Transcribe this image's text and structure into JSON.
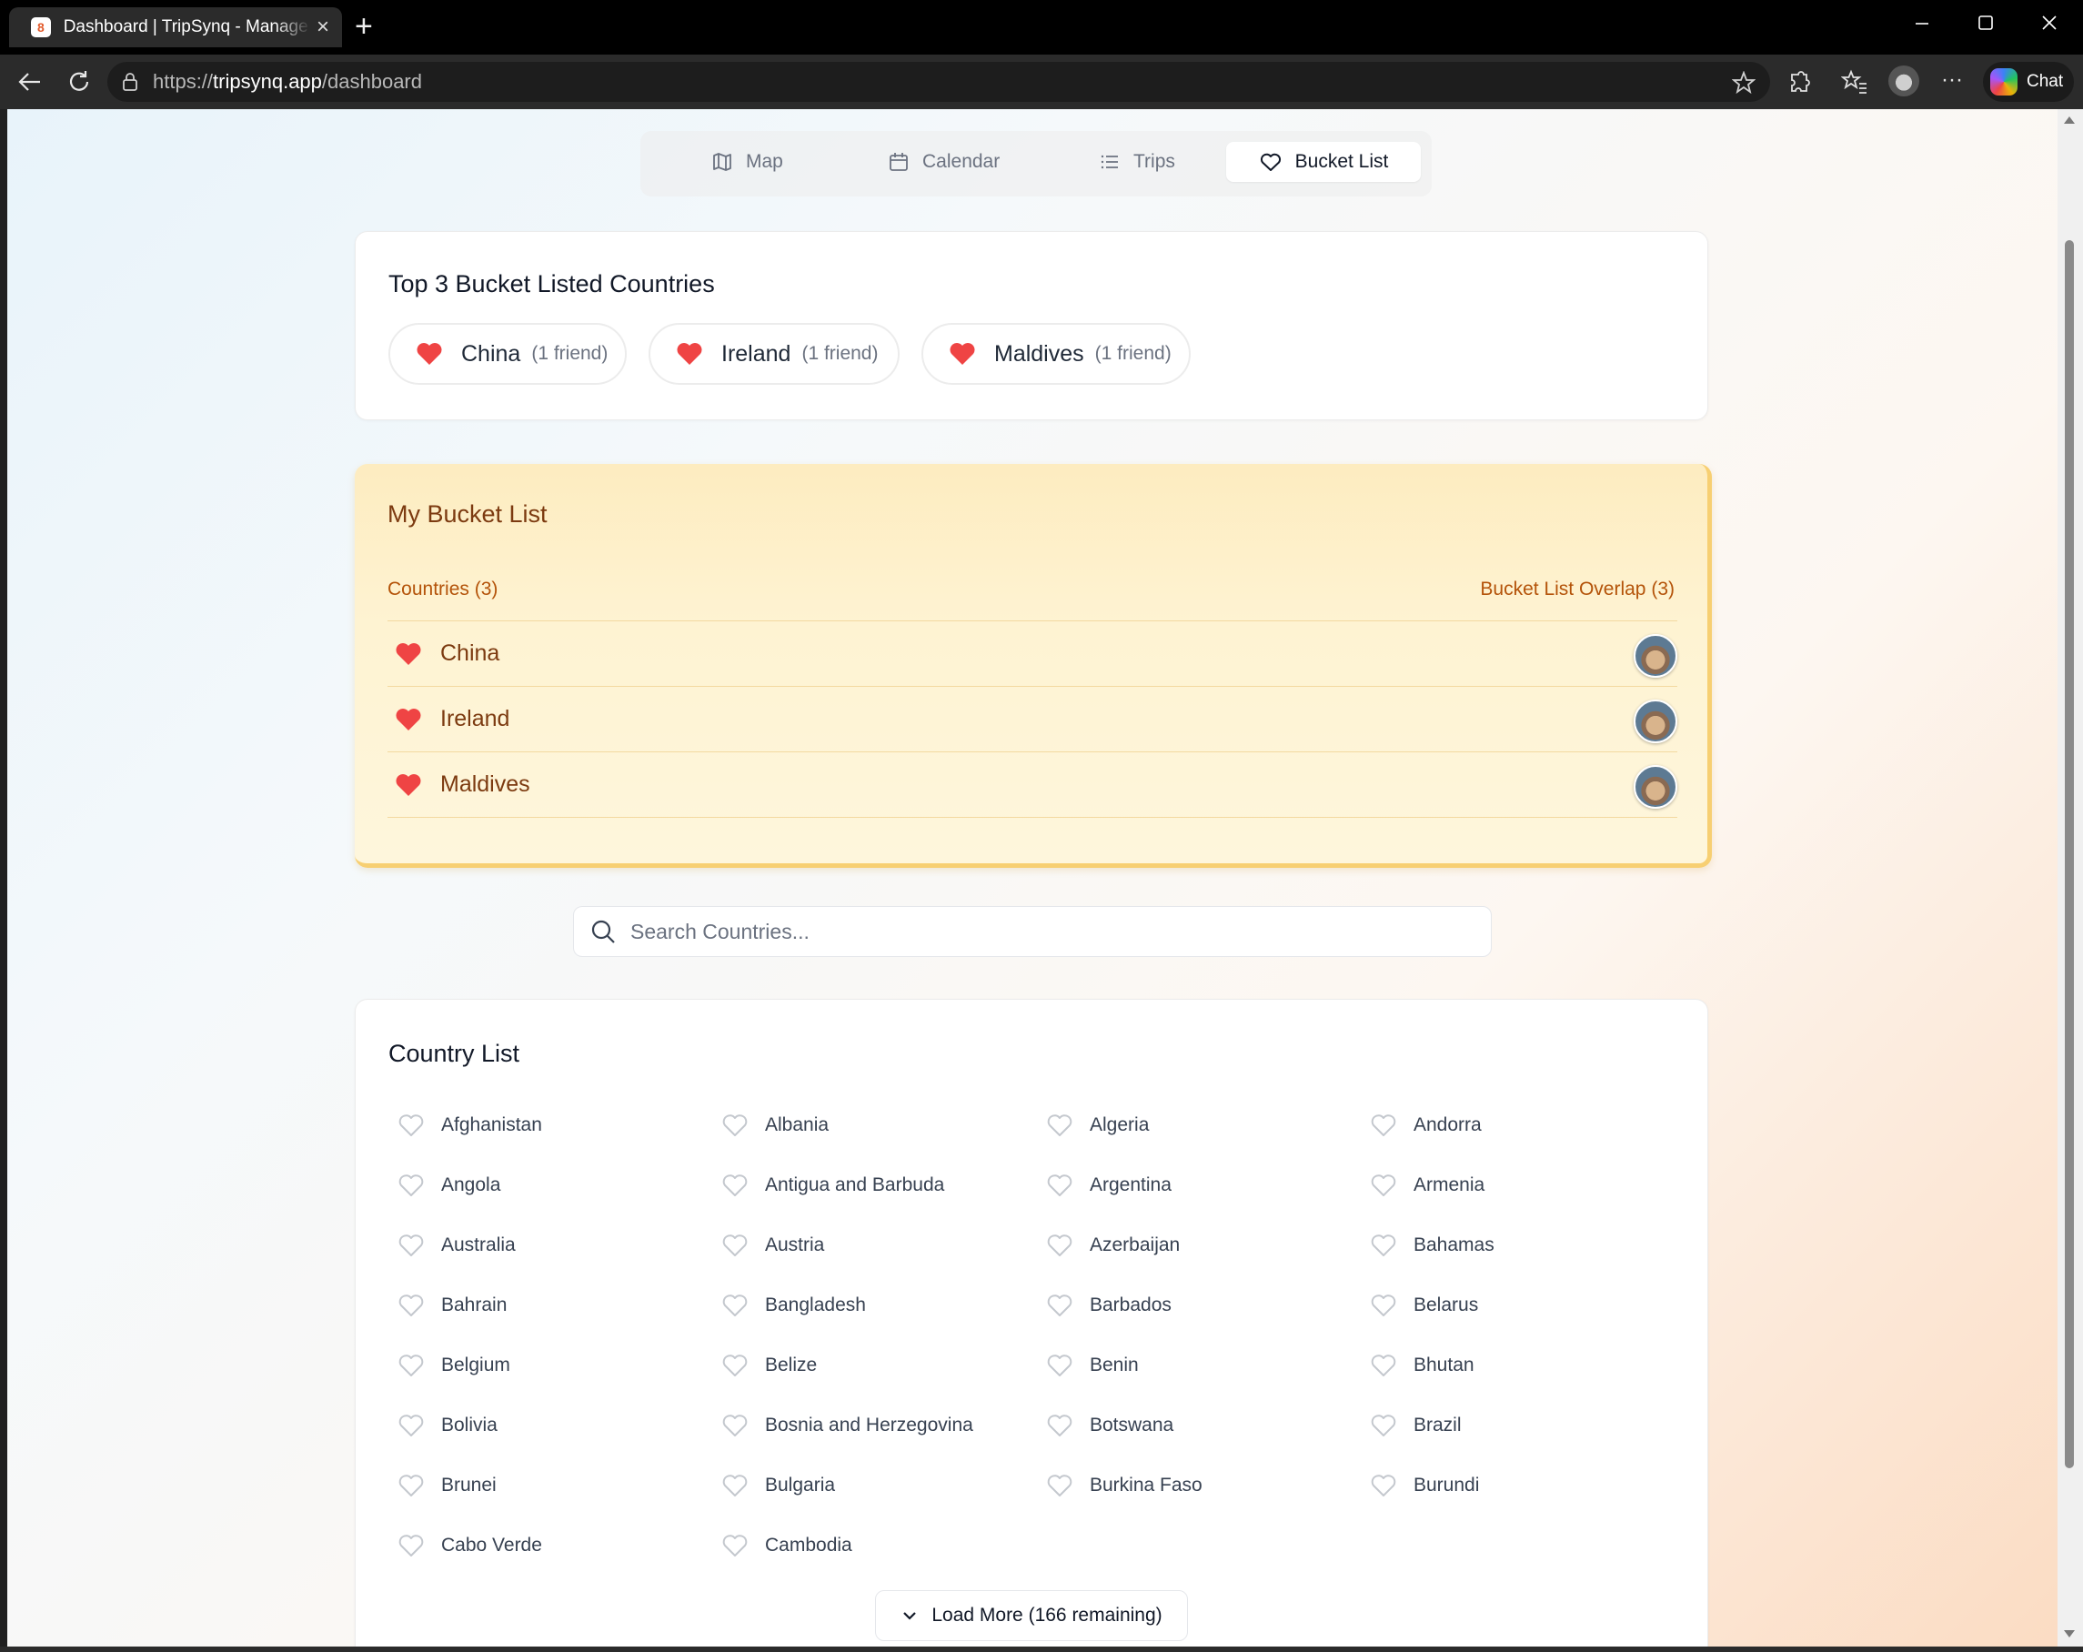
{
  "browser": {
    "tab_title": "Dashboard | TripSynq - Manage Your Trips",
    "url_prefix": "https://",
    "url_domain": "tripsynq.app",
    "url_path": "/dashboard",
    "chat_label": "Chat"
  },
  "nav": {
    "tabs": [
      {
        "label": "Map",
        "icon": "map-icon"
      },
      {
        "label": "Calendar",
        "icon": "calendar-icon"
      },
      {
        "label": "Trips",
        "icon": "list-icon"
      },
      {
        "label": "Bucket List",
        "icon": "heart-icon",
        "active": true
      }
    ]
  },
  "top3": {
    "title": "Top 3 Bucket Listed Countries",
    "items": [
      {
        "name": "China",
        "count": "(1 friend)"
      },
      {
        "name": "Ireland",
        "count": "(1 friend)"
      },
      {
        "name": "Maldives",
        "count": "(1 friend)"
      }
    ]
  },
  "my_bucket": {
    "title": "My Bucket List",
    "countries_label": "Countries (3)",
    "overlap_label": "Bucket List Overlap (3)",
    "items": [
      {
        "name": "China"
      },
      {
        "name": "Ireland"
      },
      {
        "name": "Maldives"
      }
    ]
  },
  "search": {
    "placeholder": "Search Countries..."
  },
  "country_list": {
    "title": "Country List",
    "items": [
      "Afghanistan",
      "Albania",
      "Algeria",
      "Andorra",
      "Angola",
      "Antigua and Barbuda",
      "Argentina",
      "Armenia",
      "Australia",
      "Austria",
      "Azerbaijan",
      "Bahamas",
      "Bahrain",
      "Bangladesh",
      "Barbados",
      "Belarus",
      "Belgium",
      "Belize",
      "Benin",
      "Bhutan",
      "Bolivia",
      "Bosnia and Herzegovina",
      "Botswana",
      "Brazil",
      "Brunei",
      "Bulgaria",
      "Burkina Faso",
      "Burundi",
      "Cabo Verde",
      "Cambodia"
    ],
    "load_more": "Load More (166 remaining)"
  },
  "colors": {
    "accent_heart": "#ef4444",
    "bucket_text": "#7c3a10",
    "bucket_sub": "#b45309"
  }
}
